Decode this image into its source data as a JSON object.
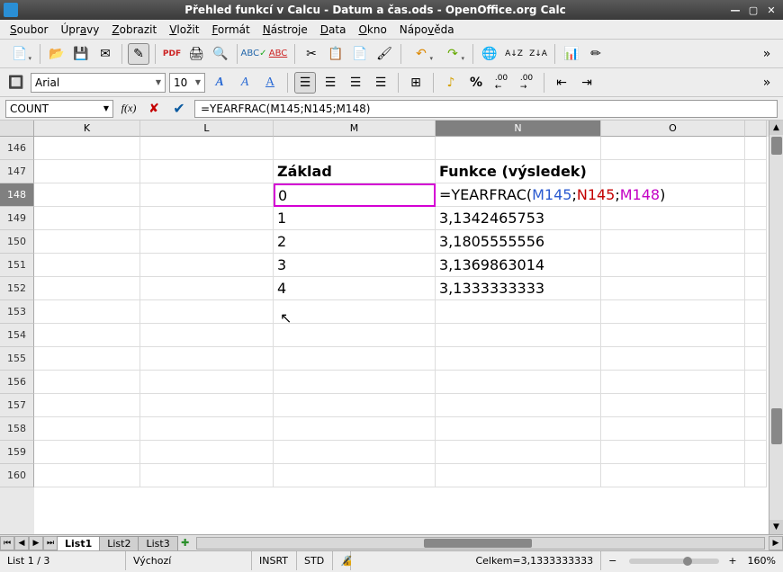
{
  "window": {
    "title": "Přehled funkcí v Calcu - Datum a čas.ods - OpenOffice.org Calc"
  },
  "menu": {
    "items": [
      "Soubor",
      "Úpravy",
      "Zobrazit",
      "Vložit",
      "Formát",
      "Nástroje",
      "Data",
      "Okno",
      "Nápověda"
    ]
  },
  "toolbar2": {
    "font": "Arial",
    "size": "10"
  },
  "formulabar": {
    "namebox": "COUNT",
    "fx": "f(x)",
    "formula": "=YEARFRAC(M145;N145;M148)"
  },
  "columns": [
    "K",
    "L",
    "M",
    "N",
    "O"
  ],
  "rows": [
    "146",
    "147",
    "148",
    "149",
    "150",
    "151",
    "152",
    "153",
    "154",
    "155",
    "156",
    "157",
    "158",
    "159",
    "160"
  ],
  "selected_col": "N",
  "selected_row": "148",
  "cells": {
    "M147": "Základ",
    "N147": "Funkce (výsledek)",
    "M148": "0",
    "N148_parts": {
      "p1": "=YEARFRAC(",
      "r1": "M145",
      "s1": ";",
      "r2": "N145",
      "s2": ";",
      "r3": "M148",
      "p2": ")"
    },
    "M149": "1",
    "N149": "3,1342465753",
    "M150": "2",
    "N150": "3,1805555556",
    "M151": "3",
    "N151": "3,1369863014",
    "M152": "4",
    "N152": "3,1333333333"
  },
  "sheets": [
    "List1",
    "List2",
    "List3"
  ],
  "status": {
    "sheet": "List 1 / 3",
    "style": "Výchozí",
    "insrt": "INSRT",
    "std": "STD",
    "sum": "Celkem=3,1333333333",
    "zoom": "160%"
  },
  "chart_data": {
    "type": "table",
    "title": "YEARFRAC basis variants",
    "columns": [
      "Základ",
      "Funkce (výsledek)"
    ],
    "rows": [
      [
        0,
        null
      ],
      [
        1,
        3.1342465753
      ],
      [
        2,
        3.1805555556
      ],
      [
        3,
        3.1369863014
      ],
      [
        4,
        3.1333333333
      ]
    ]
  }
}
